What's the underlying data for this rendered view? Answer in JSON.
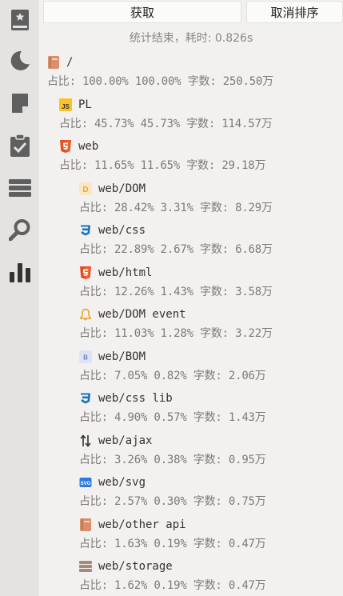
{
  "sidebar": {
    "items": [
      {
        "name": "bookmark-icon"
      },
      {
        "name": "moon-icon"
      },
      {
        "name": "note-icon"
      },
      {
        "name": "clipboard-check-icon"
      },
      {
        "name": "stack-icon"
      },
      {
        "name": "search-icon"
      },
      {
        "name": "bar-chart-icon"
      }
    ],
    "active_index": 6
  },
  "toolbar": {
    "fetch_label": "获取",
    "cancel_sort_label": "取消排序"
  },
  "status_text": "统计结束，耗时: 0.826s",
  "tree": [
    {
      "name": "/",
      "icon": "book-icon",
      "stats": "占比: 100.00% 100.00% 字数: 250.50万"
    },
    {
      "name": "PL",
      "icon": "js-icon",
      "stats": "占比: 45.73% 45.73% 字数: 114.57万"
    },
    {
      "name": "web",
      "icon": "html5-icon",
      "stats": "占比: 11.65% 11.65% 字数: 29.18万"
    },
    {
      "name": "web/DOM",
      "icon": "dom-icon",
      "stats": "占比: 28.42% 3.31% 字数: 8.29万"
    },
    {
      "name": "web/css",
      "icon": "css3-icon",
      "stats": "占比: 22.89% 2.67% 字数: 6.68万"
    },
    {
      "name": "web/html",
      "icon": "html5-icon",
      "stats": "占比: 12.26% 1.43% 字数: 3.58万"
    },
    {
      "name": "web/DOM event",
      "icon": "bell-icon",
      "stats": "占比: 11.03% 1.28% 字数: 3.22万"
    },
    {
      "name": "web/BOM",
      "icon": "bom-icon",
      "stats": "占比: 7.05% 0.82% 字数: 2.06万"
    },
    {
      "name": "web/css lib",
      "icon": "css3-icon",
      "stats": "占比: 4.90% 0.57% 字数: 1.43万"
    },
    {
      "name": "web/ajax",
      "icon": "swap-arrows-icon",
      "stats": "占比: 3.26% 0.38% 字数: 0.95万"
    },
    {
      "name": "web/svg",
      "icon": "svg-icon",
      "stats": "占比: 2.57% 0.30% 字数: 0.75万"
    },
    {
      "name": "web/other api",
      "icon": "book-icon",
      "stats": "占比: 1.63% 0.19% 字数: 0.47万"
    },
    {
      "name": "web/storage",
      "icon": "storage-icon",
      "stats": "占比: 1.62% 0.19% 字数: 0.47万"
    }
  ],
  "icon_labels": {
    "js": "JS",
    "dom": "D",
    "bom": "B",
    "svg": "SVG"
  },
  "colors": {
    "sidebar_bg": "#e4e3e1",
    "icon_gray": "#5f5f5f",
    "html5_orange": "#e44d26",
    "css3_blue": "#1572b6",
    "js_yellow": "#f7c325"
  }
}
